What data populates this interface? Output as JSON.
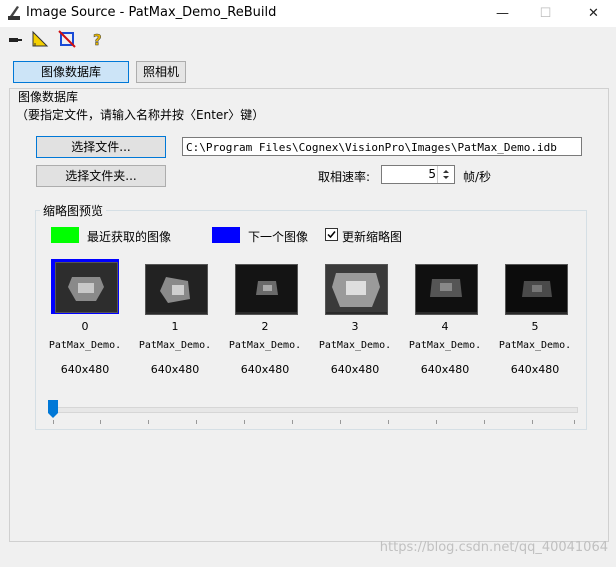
{
  "window": {
    "title": "Image Source - PatMax_Demo_ReBuild"
  },
  "toolbar": {
    "icons": [
      "plug-icon",
      "ruler-icon",
      "crop-icon",
      "help-icon"
    ]
  },
  "tabs": [
    {
      "label": "图像数据库",
      "selected": true
    },
    {
      "label": "照相机",
      "selected": false
    }
  ],
  "panel": {
    "heading": "图像数据库",
    "hint": "（要指定文件，请输入名称并按〈Enter〉键）",
    "select_file_button": "选择文件...",
    "select_folder_button": "选择文件夹...",
    "file_path": "C:\\Program Files\\Cognex\\VisionPro\\Images\\PatMax_Demo.idb",
    "rate_label": "取相速率:",
    "rate_value": "5",
    "rate_unit": "帧/秒"
  },
  "preview": {
    "group_label": "缩略图预览",
    "legend_recent": "最近获取的图像",
    "legend_next": "下一个图像",
    "update_label": "更新缩略图",
    "update_checked": true,
    "recent_color": "#00ff00",
    "next_color": "#0000ff",
    "thumbnails": [
      {
        "index": "0",
        "name": "PatMax_Demo.",
        "size": "640x480"
      },
      {
        "index": "1",
        "name": "PatMax_Demo.",
        "size": "640x480"
      },
      {
        "index": "2",
        "name": "PatMax_Demo.",
        "size": "640x480"
      },
      {
        "index": "3",
        "name": "PatMax_Demo.",
        "size": "640x480"
      },
      {
        "index": "4",
        "name": "PatMax_Demo.",
        "size": "640x480"
      },
      {
        "index": "5",
        "name": "PatMax_Demo.",
        "size": "640x480"
      }
    ],
    "slider_position": 0
  },
  "watermark": "https://blog.csdn.net/qq_40041064"
}
